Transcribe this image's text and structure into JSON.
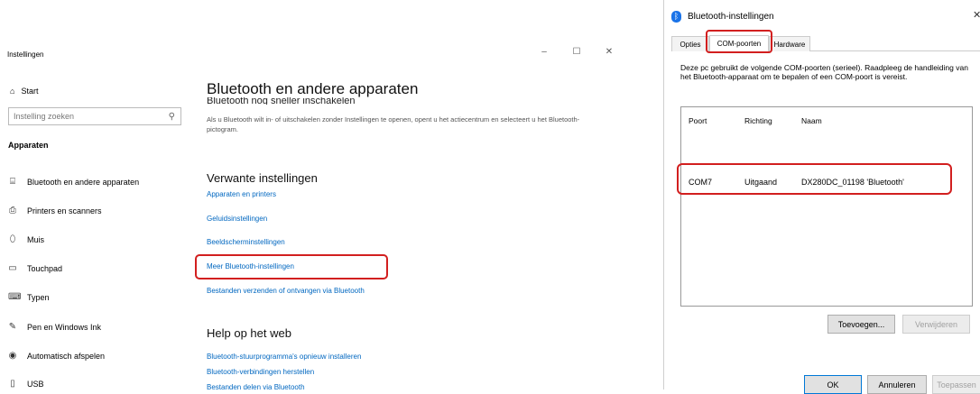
{
  "settings": {
    "app_title": "Instellingen",
    "window_controls": {
      "minimize": "–",
      "maximize": "☐",
      "close": "✕"
    },
    "start_label": "Start",
    "search_placeholder": "Instelling zoeken",
    "section_heading": "Apparaten",
    "nav": [
      {
        "label": "Bluetooth en andere apparaten",
        "icon": "bluetooth-devices-icon"
      },
      {
        "label": "Printers en scanners",
        "icon": "printer-icon"
      },
      {
        "label": "Muis",
        "icon": "mouse-icon"
      },
      {
        "label": "Touchpad",
        "icon": "touchpad-icon"
      },
      {
        "label": "Typen",
        "icon": "keyboard-icon"
      },
      {
        "label": "Pen en Windows Ink",
        "icon": "pen-icon"
      },
      {
        "label": "Automatisch afspelen",
        "icon": "autoplay-icon"
      },
      {
        "label": "USB",
        "icon": "usb-icon"
      }
    ],
    "main": {
      "title": "Bluetooth en andere apparaten",
      "cut_line": "Bluetooth nog sneller inschakelen",
      "description": "Als u Bluetooth wilt in- of uitschakelen zonder Instellingen te openen, opent u het actiecentrum en selecteert u het Bluetooth-pictogram.",
      "related_heading": "Verwante instellingen",
      "related_links": [
        "Apparaten en printers",
        "Geluidsinstellingen",
        "Beeldscherminstellingen",
        "Meer Bluetooth-instellingen",
        "Bestanden verzenden of ontvangen via Bluetooth"
      ],
      "help_heading": "Help op het web",
      "help_links": [
        "Bluetooth-stuurprogramma's opnieuw installeren",
        "Bluetooth-verbindingen herstellen",
        "Bestanden delen via Bluetooth"
      ]
    }
  },
  "dialog": {
    "title": "Bluetooth-instellingen",
    "close": "✕",
    "tabs": [
      "Opties",
      "COM-poorten",
      "Hardware"
    ],
    "active_tab": "COM-poorten",
    "description": "Deze pc gebruikt de volgende COM-poorten (serieel). Raadpleeg de handleiding van het Bluetooth-apparaat om te bepalen of een COM-poort is vereist.",
    "columns": [
      "Poort",
      "Richting",
      "Naam"
    ],
    "rows": [
      {
        "port": "COM7",
        "direction": "Uitgaand",
        "name": "DX280DC_01198 'Bluetooth'"
      }
    ],
    "buttons": {
      "add": "Toevoegen...",
      "remove": "Verwijderen",
      "ok": "OK",
      "cancel": "Annuleren",
      "apply": "Toepassen"
    }
  },
  "colors": {
    "link": "#0067c0",
    "highlight": "#d21f1f",
    "bluetooth": "#1a73e8"
  }
}
